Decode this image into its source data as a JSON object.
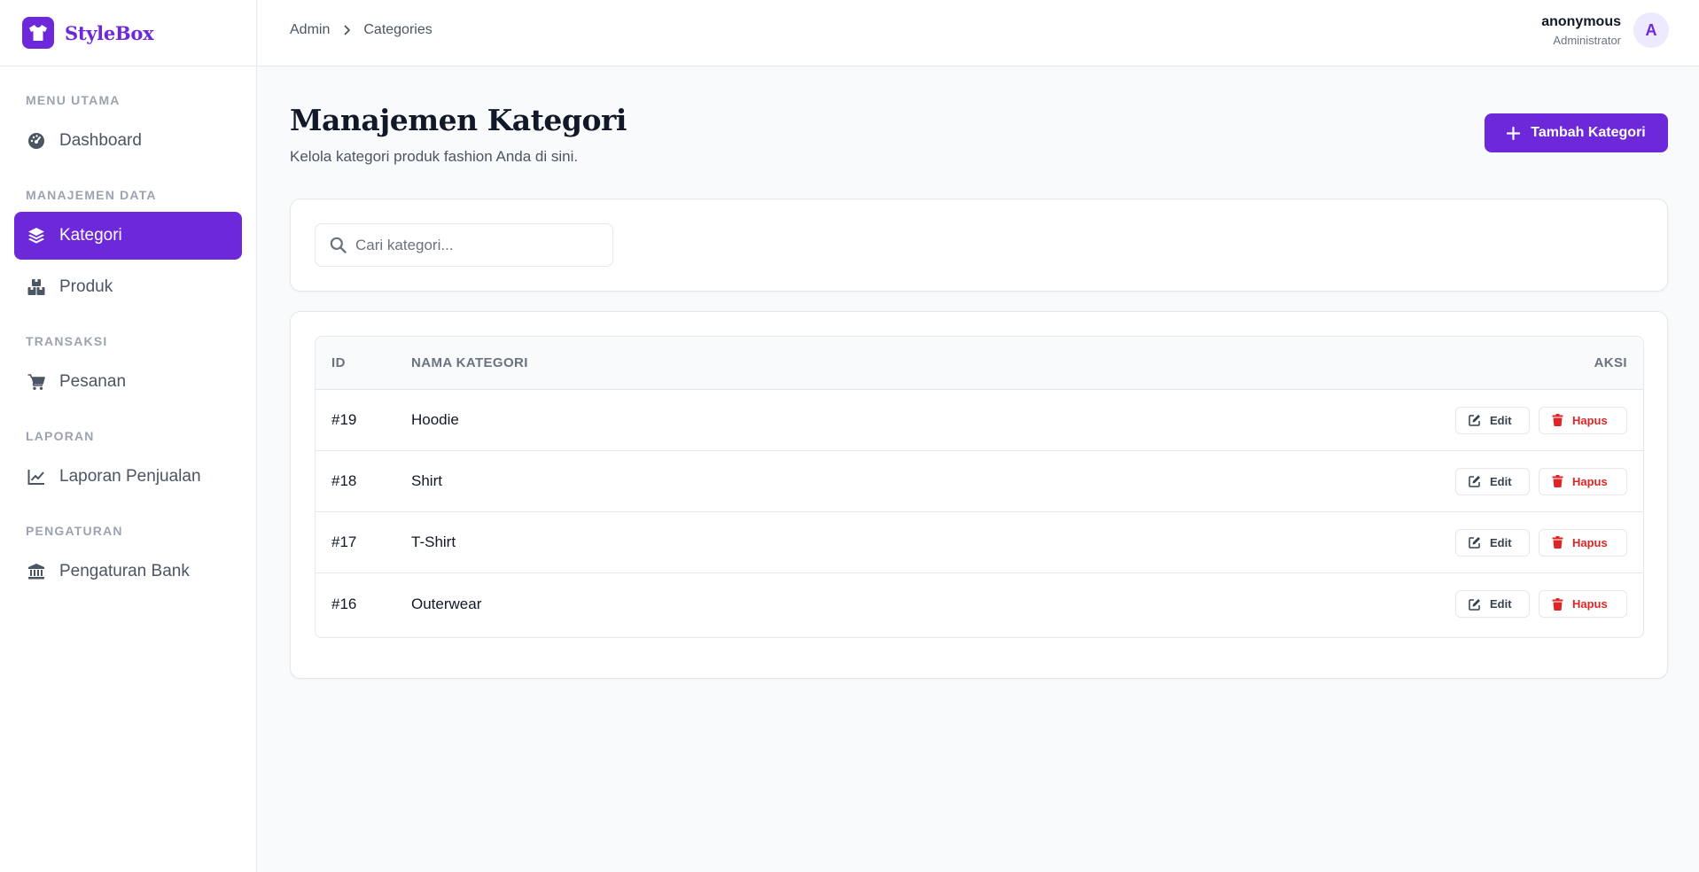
{
  "brand": {
    "name": "StyleBox"
  },
  "sidebar": {
    "sections": [
      {
        "label": "MENU UTAMA",
        "items": [
          {
            "label": "Dashboard",
            "icon": "gauge-icon"
          }
        ]
      },
      {
        "label": "MANAJEMEN DATA",
        "items": [
          {
            "label": "Kategori",
            "icon": "layers-icon",
            "active": true
          },
          {
            "label": "Produk",
            "icon": "boxes-icon"
          }
        ]
      },
      {
        "label": "TRANSAKSI",
        "items": [
          {
            "label": "Pesanan",
            "icon": "cart-icon"
          }
        ]
      },
      {
        "label": "LAPORAN",
        "items": [
          {
            "label": "Laporan Penjualan",
            "icon": "chart-line-icon"
          }
        ]
      },
      {
        "label": "PENGATURAN",
        "items": [
          {
            "label": "Pengaturan Bank",
            "icon": "bank-icon"
          }
        ]
      }
    ]
  },
  "breadcrumb": {
    "root": "Admin",
    "current": "Categories"
  },
  "user": {
    "name": "anonymous",
    "role": "Administrator",
    "initial": "A"
  },
  "page": {
    "title": "Manajemen Kategori",
    "subtitle": "Kelola kategori produk fashion Anda di sini.",
    "add_button": "Tambah Kategori"
  },
  "search": {
    "placeholder": "Cari kategori..."
  },
  "table": {
    "headers": {
      "id": "ID",
      "name": "NAMA KATEGORI",
      "actions": "AKSI"
    },
    "rows": [
      {
        "id": "#19",
        "name": "Hoodie"
      },
      {
        "id": "#18",
        "name": "Shirt"
      },
      {
        "id": "#17",
        "name": "T-Shirt"
      },
      {
        "id": "#16",
        "name": "Outerwear"
      }
    ],
    "edit_label": "Edit",
    "delete_label": "Hapus"
  },
  "colors": {
    "accent": "#6d28d9",
    "danger": "#dc2626",
    "background": "#f9fafb"
  }
}
